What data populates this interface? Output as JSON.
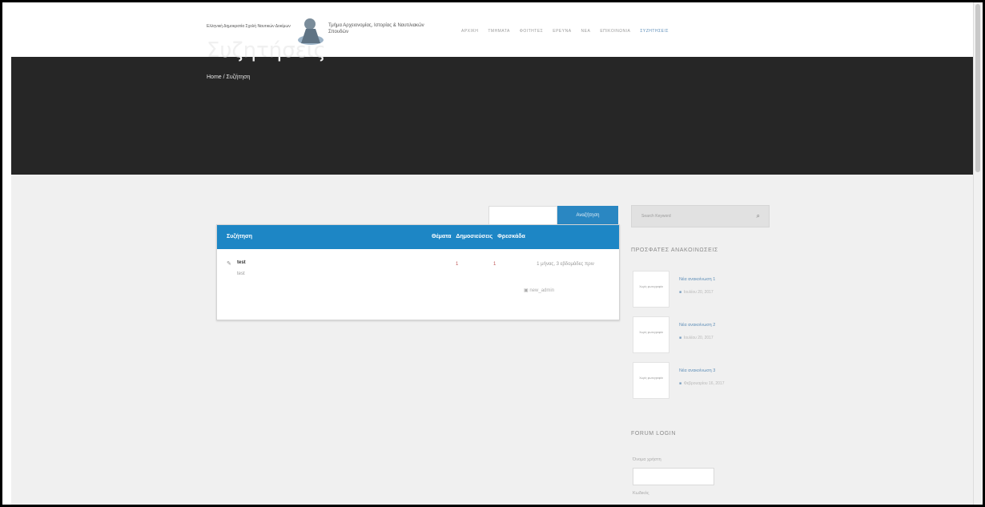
{
  "header": {
    "logo_left": "Ελληνική Δημοκρατία Σχολή Ναυτικών Δοκίμων",
    "logo_right": "Τμήμα Αρχειονομίας, Ιστορίας & Ναυτιλιακών Σπουδών",
    "nav": [
      "ΑΡΧΙΚΗ",
      "ΤΜΗΜΑΤΑ",
      "ΦΟΙΤΗΤΕΣ",
      "ΕΡΕΥΝΑ",
      "ΝΕΑ",
      "ΕΠΙΚΟΙΝΩΝΙΑ",
      "ΣΥΖΗΤΗΣΕΙΣ"
    ]
  },
  "hero": {
    "title": "Συζητήσεις",
    "breadcrumb": "Home / Συζήτηση"
  },
  "search": {
    "button": "Αναζήτηση"
  },
  "forum": {
    "head_name": "Συζήτηση",
    "head_topics": "Θέματα",
    "head_posts": "Δημοσιεύσεις",
    "head_fresh": "Φρεσκάδα",
    "row": {
      "name": "test",
      "desc": "test",
      "topics": "1",
      "posts": "1",
      "fresh": "1 μήνας, 3 εβδομάδες πριν",
      "user": "new_admin"
    }
  },
  "sidebar": {
    "search_placeholder": "Search Keyword",
    "recent_title": "ΠΡΟΣΦΑΤΕΣ ΑΝΑΚΟΙΝΩΣΕΙΣ",
    "thumb_text": "Χωρίς φωτογραφία",
    "posts": [
      {
        "title": "Νέα ανακοίνωση 1",
        "date": "Ιουλίου 20, 2017"
      },
      {
        "title": "Νέα ανακοίνωση 2",
        "date": "Ιουλίου 20, 2017"
      },
      {
        "title": "Νέα ανακοίνωση 3",
        "date": "Φεβρουαρίου 16, 2017"
      }
    ],
    "login_title": "FORUM LOGIN",
    "username_label": "Όνομα χρήστη",
    "password_label": "Κωδικός"
  },
  "colors": {
    "hero": "#262626",
    "accent": "#1d86c5",
    "content_bg": "#f0f0f0"
  }
}
